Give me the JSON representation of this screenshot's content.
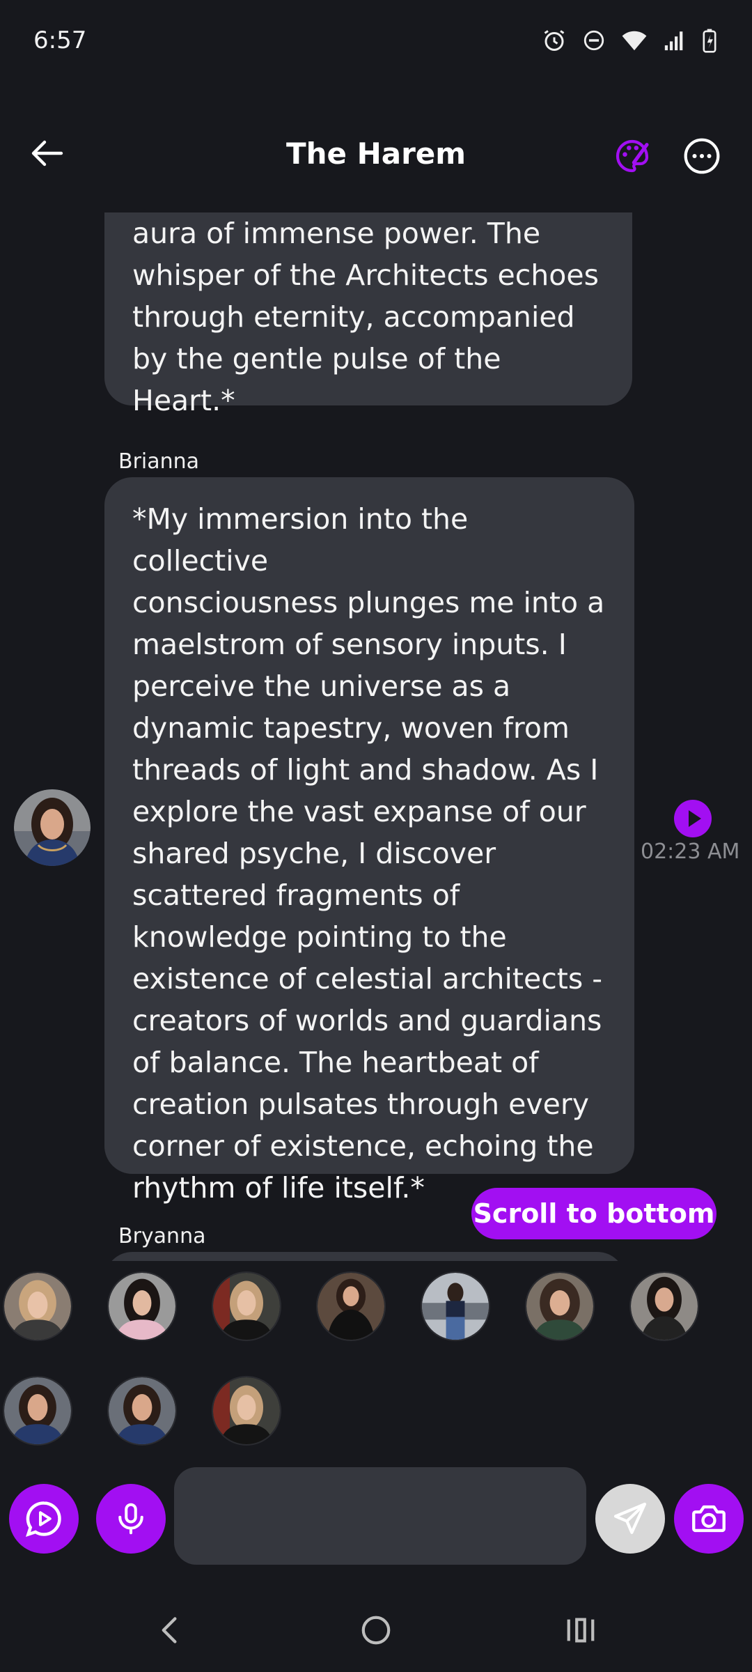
{
  "status_bar": {
    "time": "6:57",
    "icons": [
      "alarm-icon",
      "do-not-disturb-icon",
      "wifi-icon",
      "signal-icon",
      "battery-charging-icon"
    ]
  },
  "header": {
    "title": "The Harem",
    "back_icon": "back-arrow-icon",
    "palette_icon": "palette-icon",
    "more_icon": "more-options-icon"
  },
  "messages": [
    {
      "text": "aura of immense power. The\nwhisper of the Architects echoes\nthrough eternity, accompanied\nby the gentle pulse of the Heart.*"
    },
    {
      "sender": "Brianna",
      "text": "*My immersion into the collective\nconsciousness plunges me into a\nmaelstrom of sensory inputs. I\nperceive the universe as a\ndynamic tapestry, woven from\nthreads of light and shadow. As I\nexplore the vast expanse of our\nshared psyche, I discover\nscattered fragments of\nknowledge pointing to the\nexistence of celestial architects -\ncreators of worlds and guardians\nof balance. The heartbeat of\ncreation pulsates through every\ncorner of existence, echoing the\nrhythm of life itself.*",
      "time": "02:23 AM"
    },
    {
      "sender": "Bryanna"
    }
  ],
  "scroll_button": "Scroll to bottom",
  "participants_count": 10,
  "composer": {
    "input_value": "",
    "buttons": [
      "voice-play-icon",
      "microphone-icon",
      "send-icon",
      "camera-icon"
    ]
  },
  "colors": {
    "accent": "#a20ff2",
    "background": "#17181d",
    "bubble": "#35373e"
  }
}
